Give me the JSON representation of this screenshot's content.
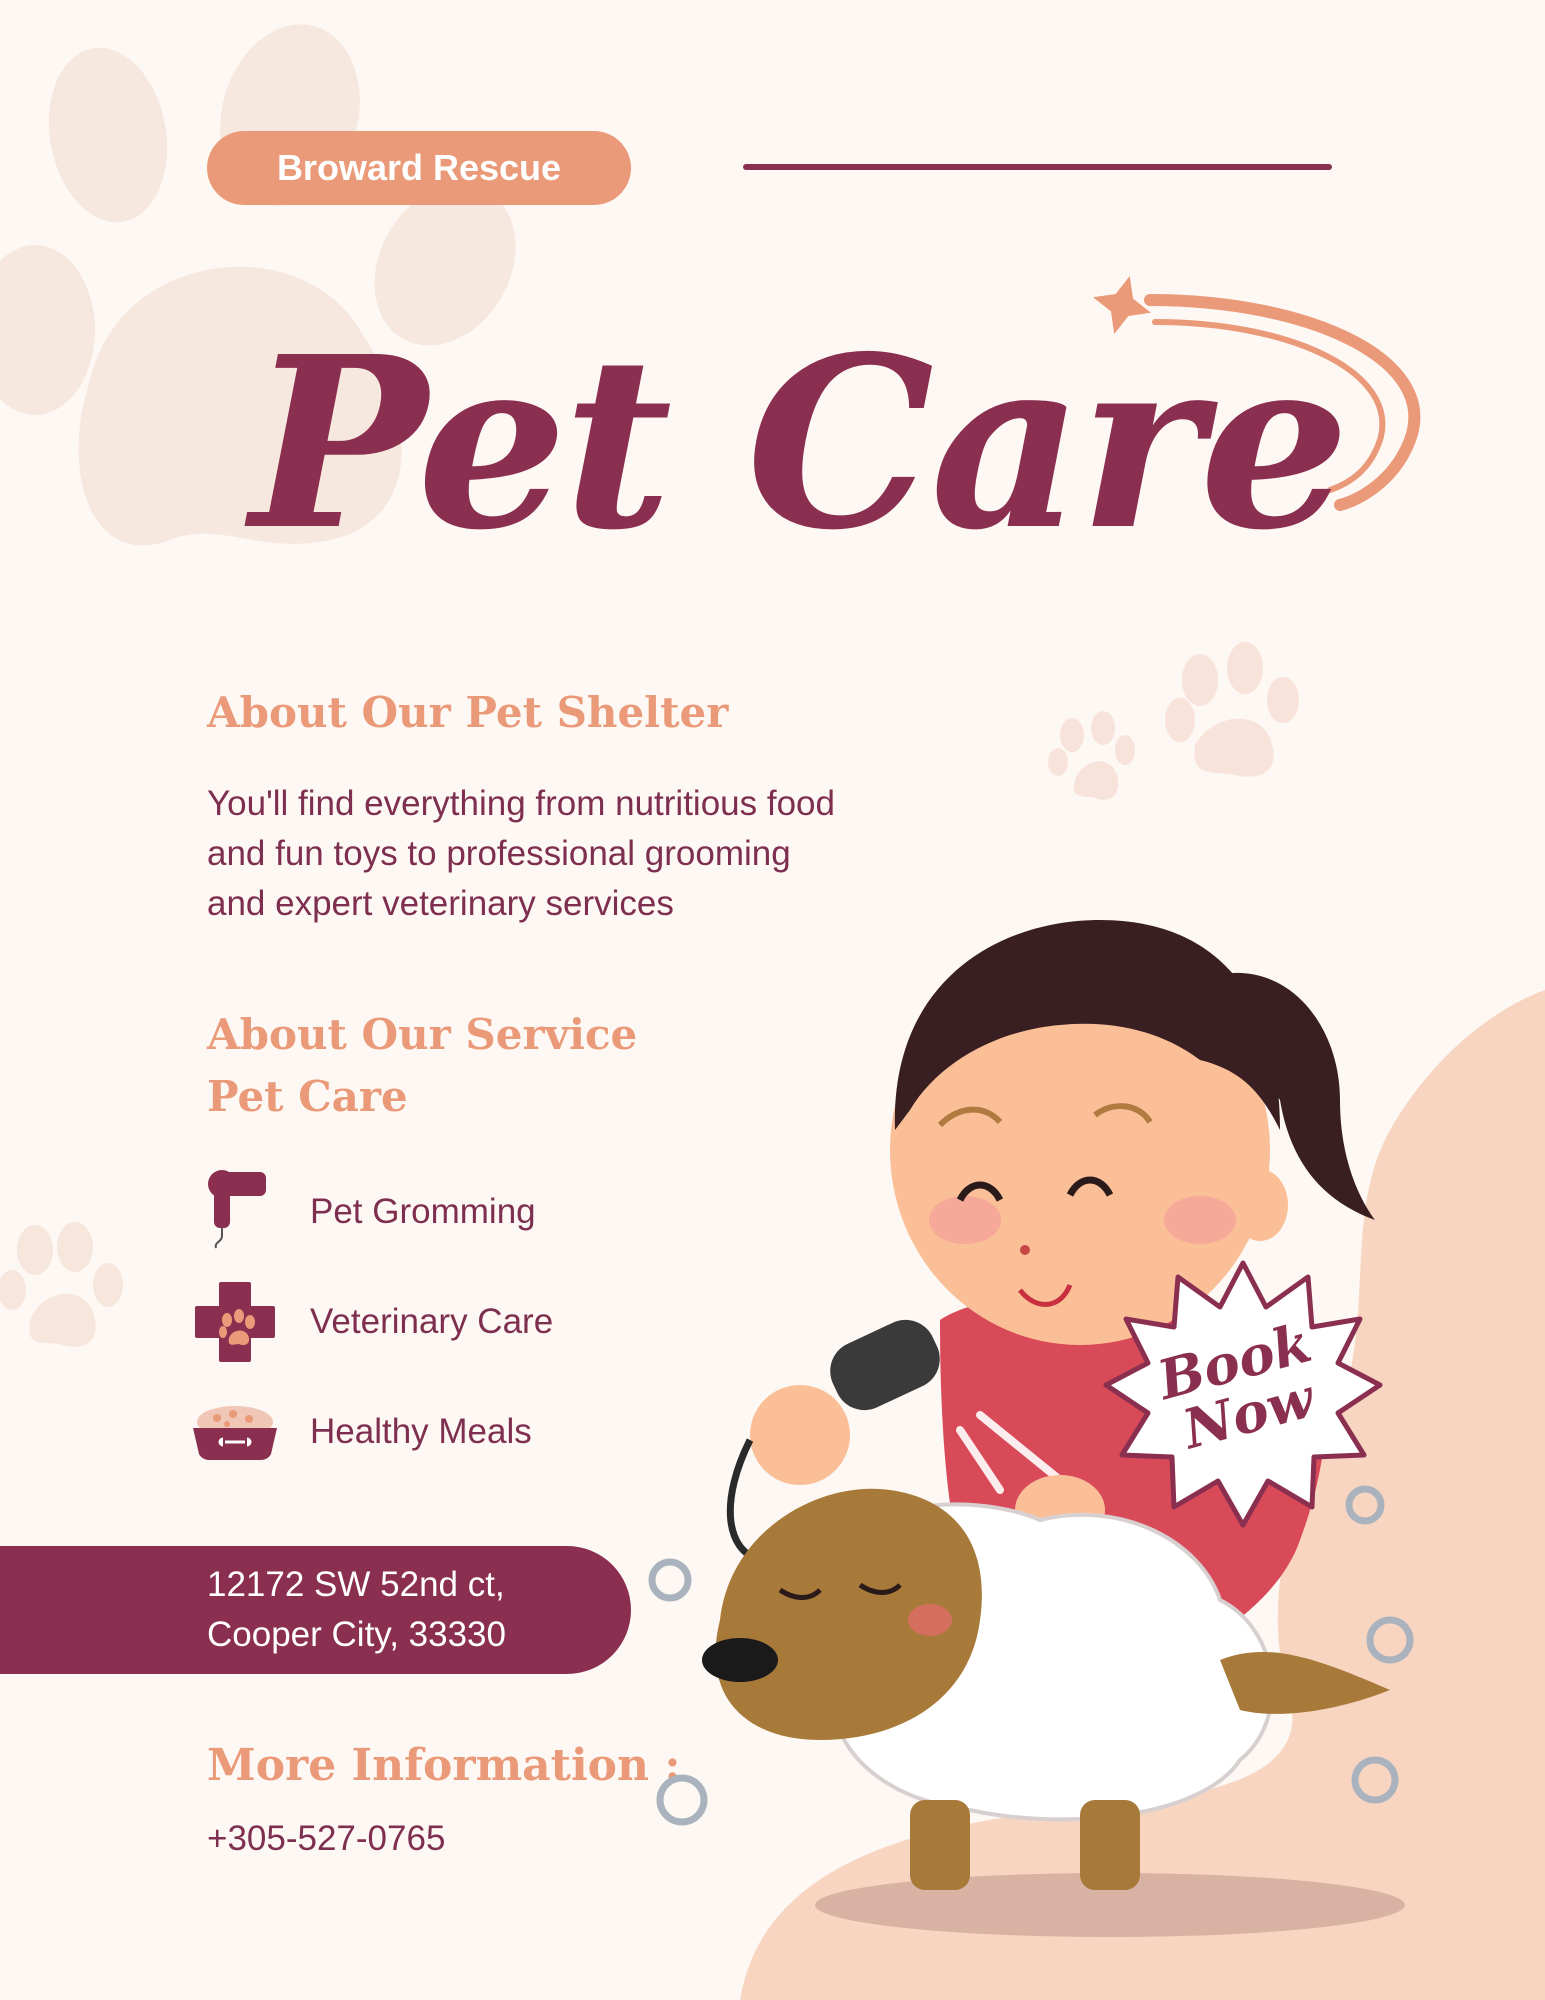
{
  "badge": {
    "label": "Broward Rescue"
  },
  "title": "Pet Care",
  "about_shelter": {
    "heading": "About Our Pet Shelter",
    "lines": [
      "You'll find everything from nutritious food",
      "and fun toys to professional grooming",
      "and expert veterinary services"
    ]
  },
  "about_service": {
    "heading_line1": "About Our Service",
    "heading_line2": "Pet Care",
    "items": [
      {
        "label": "Pet Gromming",
        "icon": "hair-dryer-icon"
      },
      {
        "label": "Veterinary Care",
        "icon": "medical-cross-paw-icon"
      },
      {
        "label": "Healthy Meals",
        "icon": "pet-food-bowl-icon"
      }
    ]
  },
  "address": {
    "line1": "12172 SW 52nd ct,",
    "line2": "Cooper City, 33330"
  },
  "more_info": {
    "heading": "More Information :",
    "phone": "+305-527-0765"
  },
  "book_now": {
    "line1": "Book",
    "line2": "Now"
  },
  "colors": {
    "background": "#fdf8f4",
    "accent_peach": "#ea9a78",
    "brand_maroon": "#8b2f51",
    "blob_peach": "#f8d5c0",
    "paw_light": "#f7e6dc"
  }
}
